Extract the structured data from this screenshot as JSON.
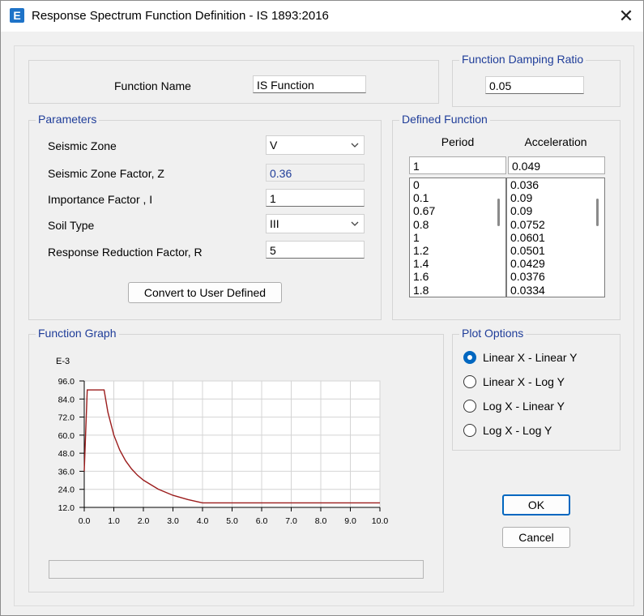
{
  "window": {
    "title": "Response Spectrum Function Definition - IS 1893:2016",
    "app_icon_letter": "E",
    "close_glyph": "✕"
  },
  "function_name": {
    "label": "Function Name",
    "value": "IS Function"
  },
  "damping": {
    "title": "Function Damping Ratio",
    "value": "0.05"
  },
  "parameters": {
    "title": "Parameters",
    "seismic_zone": {
      "label": "Seismic Zone",
      "value": "V"
    },
    "zone_factor": {
      "label": "Seismic Zone Factor, Z",
      "value": "0.36"
    },
    "importance": {
      "label": "Importance Factor , I",
      "value": "1"
    },
    "soil_type": {
      "label": "Soil Type",
      "value": "III"
    },
    "reduction": {
      "label": "Response Reduction Factor, R",
      "value": "5"
    },
    "convert_button": "Convert to User Defined"
  },
  "defined_function": {
    "title": "Defined Function",
    "period_header": "Period",
    "accel_header": "Acceleration",
    "current_period": "1",
    "current_accel": "0.049",
    "periods": [
      "0",
      "0.1",
      "0.67",
      "0.8",
      "1",
      "1.2",
      "1.4",
      "1.6",
      "1.8"
    ],
    "accels": [
      "0.036",
      "0.09",
      "0.09",
      "0.0752",
      "0.0601",
      "0.0501",
      "0.0429",
      "0.0376",
      "0.0334"
    ]
  },
  "graph": {
    "title": "Function Graph",
    "exponent_label": "E-3"
  },
  "plot_options": {
    "title": "Plot Options",
    "options": [
      {
        "label": "Linear X - Linear Y",
        "selected": true
      },
      {
        "label": "Linear X - Log Y",
        "selected": false
      },
      {
        "label": "Log X - Linear Y",
        "selected": false
      },
      {
        "label": "Log X - Log Y",
        "selected": false
      }
    ]
  },
  "buttons": {
    "ok": "OK",
    "cancel": "Cancel"
  },
  "chart_data": {
    "type": "line",
    "title": "",
    "xlabel": "",
    "ylabel": "",
    "y_scale_note": "E-3",
    "xlim": [
      0,
      10
    ],
    "ylim": [
      12,
      96
    ],
    "xticks": [
      "0.0",
      "1.0",
      "2.0",
      "3.0",
      "4.0",
      "5.0",
      "6.0",
      "7.0",
      "8.0",
      "9.0",
      "10.0"
    ],
    "yticks": [
      "12.0",
      "24.0",
      "36.0",
      "48.0",
      "60.0",
      "72.0",
      "84.0",
      "96.0"
    ],
    "grid": true,
    "color": "#9b1c1c",
    "series": [
      {
        "x": [
          0,
          0.1,
          0.67,
          0.8,
          1.0,
          1.2,
          1.4,
          1.6,
          1.8,
          2.0,
          2.5,
          3.0,
          3.5,
          4.0,
          4.25,
          10.0
        ],
        "y": [
          36,
          90,
          90,
          75.2,
          60.1,
          50.1,
          42.9,
          37.6,
          33.4,
          30.1,
          24.1,
          20.0,
          17.2,
          15.0,
          15.0,
          15.0
        ]
      }
    ]
  }
}
